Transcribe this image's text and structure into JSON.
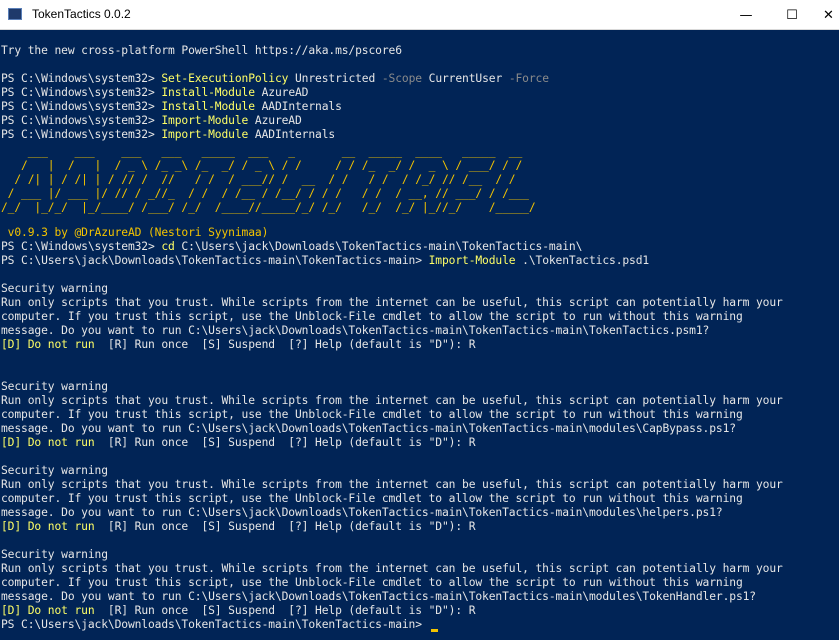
{
  "window": {
    "title": "TokenTactics 0.0.2",
    "minimize": "—",
    "maximize": "☐",
    "close": "✕"
  },
  "console": {
    "intro": "Try the new cross-platform PowerShell https://aka.ms/pscore6",
    "prompt1": "PS C:\\Windows\\system32> ",
    "cmd1": "Set-ExecutionPolicy",
    "cmd1_a1": " Unrestricted ",
    "cmd1_p1": "-Scope",
    "cmd1_a2": " CurrentUser ",
    "cmd1_p2": "-Force",
    "cmd2": "Install-Module",
    "cmd2_arg": " AzureAD",
    "cmd3": "Install-Module",
    "cmd3_arg": " AADInternals",
    "cmd4": "Import-Module",
    "cmd4_arg": " AzureAD",
    "cmd5": "Import-Module",
    "cmd5_arg": " AADInternals",
    "banner": [
      "    ___    ___    ___   ___   _____  ___   _       __  _____  ____   _____  __",
      "   /   |  /   |  / _ \\ /_ _\\ /_  _/ / _ \\ / /     / / /_  _/ /  _ \\ / ___/ / /",
      "  / /| | / /| | / // /  //   / /  / ___// /  __  / /   / /  / /_/ // /__  / /",
      " / ___ |/ ___ |/ // / _//_  / /  / /__ / /__/ / / /   / /  / __, // ___/ / /___",
      "/_/  |_/_/  |_/____/ /___/ /_/  /____//_____/_/ /_/   /_/  /_/ |_//_/    /_____/"
    ],
    "version": " v0.9.3 by @DrAzureAD (Nestori Syynimaa)",
    "prompt2": "PS C:\\Windows\\system32> ",
    "cd_cmd": "cd",
    "cd_arg": " C:\\Users\\jack\\Downloads\\TokenTactics-main\\TokenTactics-main\\",
    "prompt3": "PS C:\\Users\\jack\\Downloads\\TokenTactics-main\\TokenTactics-main> ",
    "import_cmd": "Import-Module",
    "import_arg": " .\\TokenTactics.psd1",
    "warnings": [
      {
        "heading": "Security warning",
        "l1": "Run only scripts that you trust. While scripts from the internet can be useful, this script can potentially harm your",
        "l2": "computer. If you trust this script, use the Unblock-File cmdlet to allow the script to run without this warning",
        "l3": "message. Do you want to run C:\\Users\\jack\\Downloads\\TokenTactics-main\\TokenTactics-main\\TokenTactics.psm1?",
        "choice": "[D] Do not run",
        "rest": "  [R] Run once  [S] Suspend  [?] Help (default is \"D\"): R"
      },
      {
        "heading": "Security warning",
        "l1": "Run only scripts that you trust. While scripts from the internet can be useful, this script can potentially harm your",
        "l2": "computer. If you trust this script, use the Unblock-File cmdlet to allow the script to run without this warning",
        "l3": "message. Do you want to run C:\\Users\\jack\\Downloads\\TokenTactics-main\\TokenTactics-main\\modules\\CapBypass.ps1?",
        "choice": "[D] Do not run",
        "rest": "  [R] Run once  [S] Suspend  [?] Help (default is \"D\"): R"
      },
      {
        "heading": "Security warning",
        "l1": "Run only scripts that you trust. While scripts from the internet can be useful, this script can potentially harm your",
        "l2": "computer. If you trust this script, use the Unblock-File cmdlet to allow the script to run without this warning",
        "l3": "message. Do you want to run C:\\Users\\jack\\Downloads\\TokenTactics-main\\TokenTactics-main\\modules\\helpers.ps1?",
        "choice": "[D] Do not run",
        "rest": "  [R] Run once  [S] Suspend  [?] Help (default is \"D\"): R"
      },
      {
        "heading": "Security warning",
        "l1": "Run only scripts that you trust. While scripts from the internet can be useful, this script can potentially harm your",
        "l2": "computer. If you trust this script, use the Unblock-File cmdlet to allow the script to run without this warning",
        "l3": "message. Do you want to run C:\\Users\\jack\\Downloads\\TokenTactics-main\\TokenTactics-main\\modules\\TokenHandler.ps1?",
        "choice": "[D] Do not run",
        "rest": "  [R] Run once  [S] Suspend  [?] Help (default is \"D\"): R"
      }
    ],
    "final_prompt": "PS C:\\Users\\jack\\Downloads\\TokenTactics-main\\TokenTactics-main> "
  },
  "colors": {
    "background": "#012456",
    "text": "#e6e6e6",
    "command": "#ffff66",
    "parameter": "#8a8a8a",
    "banner": "#f3c300"
  }
}
